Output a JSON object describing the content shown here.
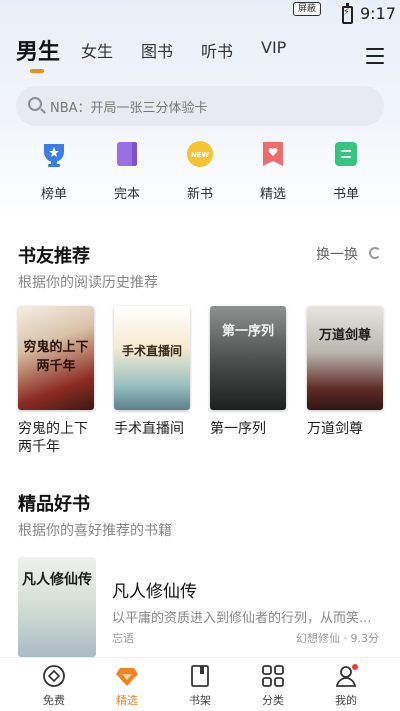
{
  "status_bar": {
    "tag": "屏蔽",
    "time": "9:17"
  },
  "tabs": [
    {
      "label": "男生",
      "active": true
    },
    {
      "label": "女生"
    },
    {
      "label": "图书"
    },
    {
      "label": "听书"
    },
    {
      "label": "VIP"
    }
  ],
  "search": {
    "placeholder": "NBA：开局一张三分体验卡"
  },
  "quick_links": [
    {
      "label": "榜单",
      "icon": "trophy-icon",
      "color": "#3b7ee8"
    },
    {
      "label": "完本",
      "icon": "book-complete-icon",
      "color": "#9a6fe0"
    },
    {
      "label": "新书",
      "icon": "new-badge-icon",
      "color": "#f6c431"
    },
    {
      "label": "精选",
      "icon": "heart-bookmark-icon",
      "color": "#f26b6b"
    },
    {
      "label": "书单",
      "icon": "booklist-icon",
      "color": "#34c57e"
    }
  ],
  "section_friends": {
    "title": "书友推荐",
    "subtitle": "根据你的阅读历史推荐",
    "refresh_label": "换一换",
    "books": [
      {
        "title": "穷鬼的上下两千年",
        "cover_text": "穷鬼的上下两千年"
      },
      {
        "title": "手术直播间",
        "cover_text": "手术直播间"
      },
      {
        "title": "第一序列",
        "cover_text": "第一序列"
      },
      {
        "title": "万道剑尊",
        "cover_text": "万道剑尊"
      }
    ]
  },
  "section_quality": {
    "title": "精品好书",
    "subtitle": "根据你的喜好推荐的书籍",
    "featured": {
      "title": "凡人修仙传",
      "cover_text": "凡人修仙传",
      "description": "以平庸的资质进入到修仙者的行列，从而笑...",
      "author": "忘语",
      "genre": "幻想修仙",
      "rating": "9.3分"
    }
  },
  "bottom_nav": [
    {
      "label": "免费",
      "icon": "free-coin-icon"
    },
    {
      "label": "精选",
      "icon": "gem-icon",
      "active": true
    },
    {
      "label": "书架",
      "icon": "bookshelf-icon"
    },
    {
      "label": "分类",
      "icon": "grid-icon"
    },
    {
      "label": "我的",
      "icon": "user-icon"
    }
  ],
  "colors": {
    "accent": "#f28a1e",
    "search_bg": "#e7ebf1"
  }
}
